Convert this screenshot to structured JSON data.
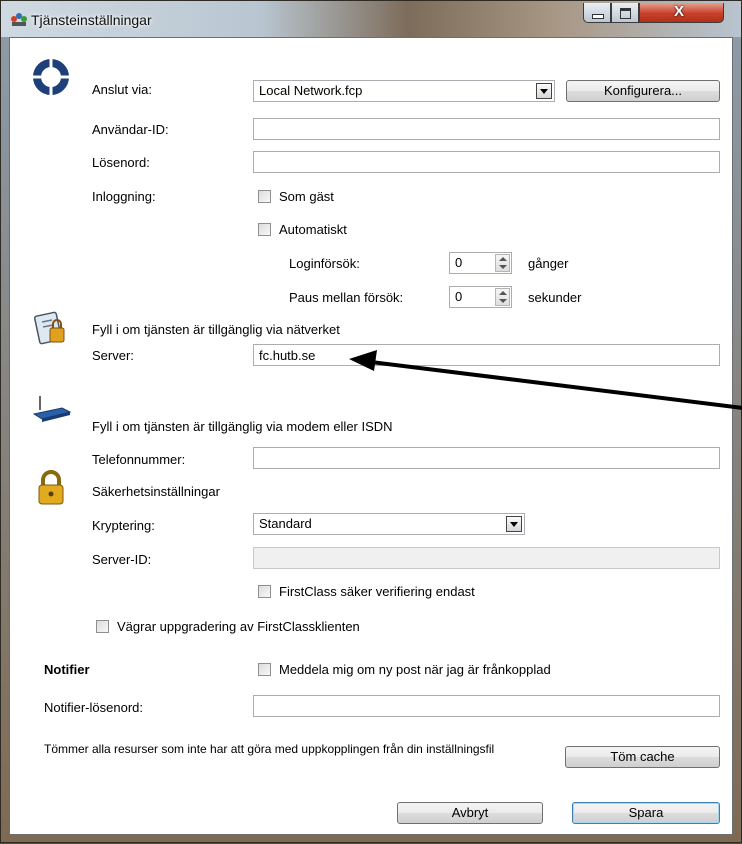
{
  "window": {
    "title": "Tjänsteinställningar",
    "close_glyph": "X"
  },
  "connect": {
    "label": "Anslut via:",
    "value": "Local Network.fcp",
    "configure_button": "Konfigurera..."
  },
  "user_id": {
    "label": "Användar-ID:",
    "value": ""
  },
  "password": {
    "label": "Lösenord:",
    "value": ""
  },
  "login": {
    "label": "Inloggning:",
    "guest_label": "Som gäst",
    "auto_label": "Automatiskt",
    "attempts_label": "Loginförsök:",
    "attempts_value": "0",
    "attempts_unit": "gånger",
    "pause_label": "Paus mellan försök:",
    "pause_value": "0",
    "pause_unit": "sekunder"
  },
  "network": {
    "heading": "Fyll i om tjänsten är tillgänglig via nätverket",
    "server_label": "Server:",
    "server_value": "fc.hutb.se"
  },
  "modem": {
    "heading": "Fyll i om tjänsten är tillgänglig via modem eller ISDN",
    "phone_label": "Telefonnummer:",
    "phone_value": ""
  },
  "security": {
    "heading": "Säkerhetsinställningar",
    "encryption_label": "Kryptering:",
    "encryption_value": "Standard",
    "server_id_label": "Server-ID:",
    "server_id_value": "",
    "verify_label": "FirstClass säker verifiering endast"
  },
  "upgrade": {
    "label": "Vägrar uppgradering av FirstClassklienten"
  },
  "notifier": {
    "heading": "Notifier",
    "notify_label": "Meddela mig om ny post när jag är frånkopplad",
    "password_label": "Notifier-lösenord:",
    "password_value": ""
  },
  "cache": {
    "description": "Tömmer alla resurser som inte har att göra med uppkopplingen från din inställningsfil",
    "button": "Töm cache"
  },
  "footer": {
    "cancel_button": "Avbryt",
    "save_button": "Spara"
  },
  "icons": [
    "network-services-icon",
    "connection-ring-icon",
    "network-card-icon",
    "modem-icon",
    "padlock-icon"
  ]
}
